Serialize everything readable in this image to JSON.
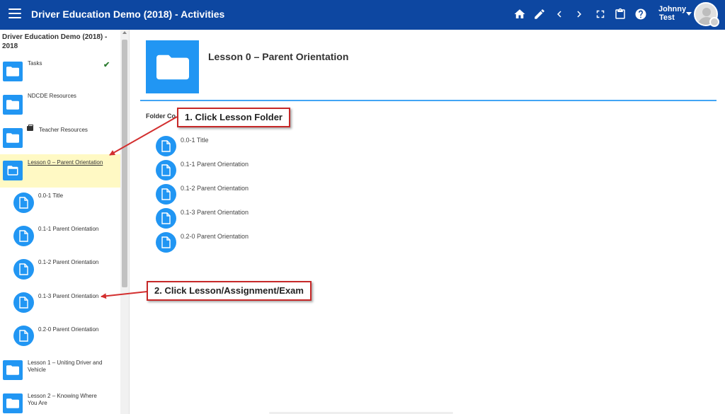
{
  "header": {
    "title": "Driver Education Demo (2018) - Activities",
    "user_first": "Johnny",
    "user_last": "Test",
    "icons": [
      "menu-icon",
      "home-icon",
      "edit-icon",
      "chevron-left-icon",
      "chevron-right-icon",
      "fullscreen-icon",
      "clipboard-icon",
      "help-icon"
    ]
  },
  "sidebar": {
    "course_title": "Driver Education Demo (2018) - 2018",
    "items": [
      {
        "label": "Tasks",
        "icon": "folder-icon"
      },
      {
        "label": "NDCDE Resources",
        "icon": "folder-icon"
      },
      {
        "label": "Teacher Resources",
        "icon": "folder-icon"
      },
      {
        "label": "Lesson 0 – Parent Orientation",
        "icon": "folder-open-icon"
      },
      {
        "label": "0.0-1 Title",
        "icon": "document-icon"
      },
      {
        "label": "0.1-1 Parent Orientation",
        "icon": "document-icon"
      },
      {
        "label": "0.1-2 Parent Orientation",
        "icon": "document-icon"
      },
      {
        "label": "0.1-3 Parent Orientation",
        "icon": "document-icon"
      },
      {
        "label": "0.2-0 Parent Orientation",
        "icon": "document-icon"
      },
      {
        "label": "Lesson 1 – Uniting Driver and Vehicle",
        "icon": "folder-icon"
      },
      {
        "label": "Lesson 2 – Knowing Where You Are",
        "icon": "folder-icon"
      }
    ]
  },
  "main": {
    "lesson_title": "Lesson 0 – Parent Orientation",
    "folder_contents_label": "Folder Co",
    "items": [
      "0.0-1 Title",
      "0.1-1 Parent Orientation",
      "0.1-2 Parent Orientation",
      "0.1-3 Parent Orientation",
      "0.2-0 Parent Orientation"
    ]
  },
  "callouts": {
    "step1": "1. Click Lesson Folder",
    "step2": "2. Click Lesson/Assignment/Exam"
  },
  "colors": {
    "topbar": "#0d47a1",
    "accent": "#2196f3",
    "active_row": "#fff9c4",
    "callout_border": "#c62828"
  }
}
